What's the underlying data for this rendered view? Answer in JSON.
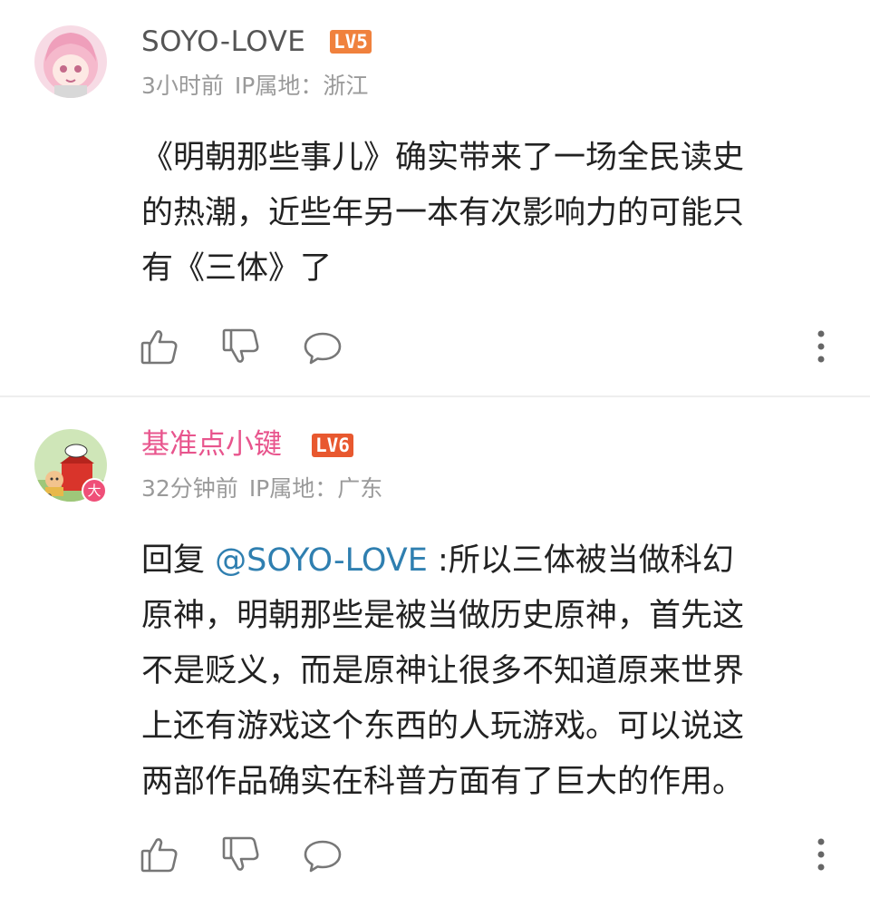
{
  "comments": [
    {
      "username": "SOYO-LOVE",
      "username_color": "#555555",
      "level": "LV5",
      "level_color": "#f0813d",
      "time": "3小时前",
      "ip_location": "IP属地：浙江",
      "content_lines": [
        "《明朝那些事儿》确实带来了一场全民读史",
        "的热潮，近些年另一本有次影响力的可能只",
        "有《三体》了"
      ],
      "icons": [
        "like-icon",
        "dislike-icon",
        "reply-icon",
        "more-icon"
      ]
    },
    {
      "username": "基准点小键",
      "username_color": "#e8558d",
      "level": "LV6",
      "level_color": "#e8582f",
      "time": "32分钟前",
      "ip_location": "IP属地：广东",
      "avatar_badge": "大",
      "reply_prefix": "回复 ",
      "mention": "@SOYO-LOVE",
      "content_lines": [
        " :所以三体被当做科幻",
        "原神，明朝那些是被当做历史原神，首先这",
        "不是贬义，而是原神让很多不知道原来世界",
        "上还有游戏这个东西的人玩游戏。可以说这",
        "两部作品确实在科普方面有了巨大的作用。"
      ],
      "icons": [
        "like-icon",
        "dislike-icon",
        "reply-icon",
        "more-icon"
      ]
    }
  ]
}
